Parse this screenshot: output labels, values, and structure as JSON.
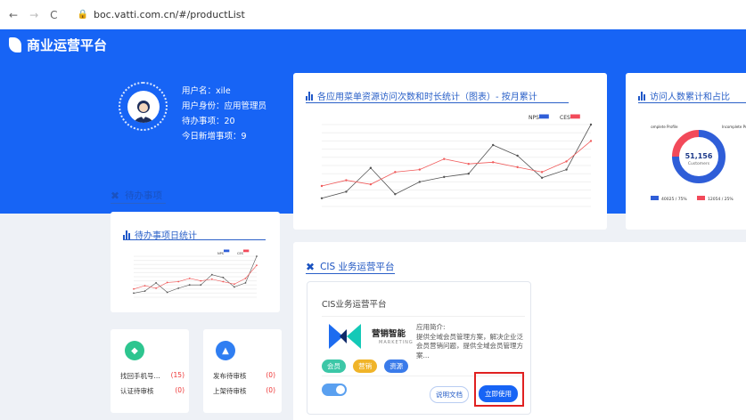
{
  "browser": {
    "url": "boc.vatti.com.cn/#/productList"
  },
  "app": {
    "title": "商业运营平台"
  },
  "user": {
    "username": "用户名：xile",
    "role": "用户身份：应用管理员",
    "pending": "待办事项：20",
    "today_new": "今日新增事项：9"
  },
  "sections": {
    "todo": "待办事项",
    "cis": "CIS 业务运营平台"
  },
  "cards": {
    "visit_chart_title": "各应用菜单资源访问次数和时长统计（图表）- 按月累计",
    "people_chart_title": "访问人数累计和占比",
    "todo_stats_title": "待办事项日统计"
  },
  "chart_data": [
    {
      "type": "line",
      "title": "各应用菜单资源访问次数和时长统计（图表）- 按月累计",
      "series": [
        {
          "name": "NPS",
          "color": "#555555",
          "values": [
            10,
            18,
            47,
            15,
            30,
            36,
            40,
            75,
            62,
            35,
            45,
            100
          ]
        },
        {
          "name": "CES",
          "color": "#f05a5a",
          "values": [
            25,
            32,
            27,
            42,
            45,
            58,
            52,
            54,
            48,
            42,
            55,
            80
          ]
        }
      ],
      "ylim": [
        0,
        100
      ]
    },
    {
      "type": "pie",
      "title": "访问人数累计和占比",
      "center_value": "51,156",
      "center_label": "Customers",
      "labels": [
        "Complete Profile",
        "Incomplete Profile"
      ],
      "values": [
        75,
        25
      ],
      "legend": [
        "40025 / 75%",
        "12054 / 25%"
      ],
      "colors": [
        "#2f5ed8",
        "#f24a5a"
      ]
    },
    {
      "type": "line",
      "title": "待办事项日统计",
      "series": [
        {
          "name": "NPS",
          "color": "#555555",
          "values": [
            10,
            15,
            35,
            12,
            22,
            30,
            30,
            55,
            48,
            25,
            35,
            100
          ]
        },
        {
          "name": "CES",
          "color": "#f05a5a",
          "values": [
            20,
            28,
            22,
            36,
            38,
            46,
            40,
            44,
            38,
            32,
            46,
            78
          ]
        }
      ],
      "ylim": [
        0,
        100
      ]
    }
  ],
  "stats_left": {
    "rows": [
      {
        "label": "找回手机号...",
        "value": "(15)"
      },
      {
        "label": "认证待审核",
        "value": "(0)"
      }
    ]
  },
  "stats_right": {
    "rows": [
      {
        "label": "发布待审核",
        "value": "(0)"
      },
      {
        "label": "上架待审核",
        "value": "(0)"
      }
    ]
  },
  "cis_app": {
    "name": "CIS业务运营平台",
    "logo_cn": "营销智能",
    "logo_en": "MARKETING",
    "intro_title": "应用简介:",
    "intro_text": "提供全域会员管理方案，解决企业泛会员营销问题，提供全域会员管理方案...",
    "tags": [
      "会员",
      "营销",
      "资源"
    ],
    "tag_colors": [
      "#3cc7a7",
      "#f0b429",
      "#3a7bea"
    ],
    "doc_button": "说明文档",
    "use_button": "立即使用"
  }
}
